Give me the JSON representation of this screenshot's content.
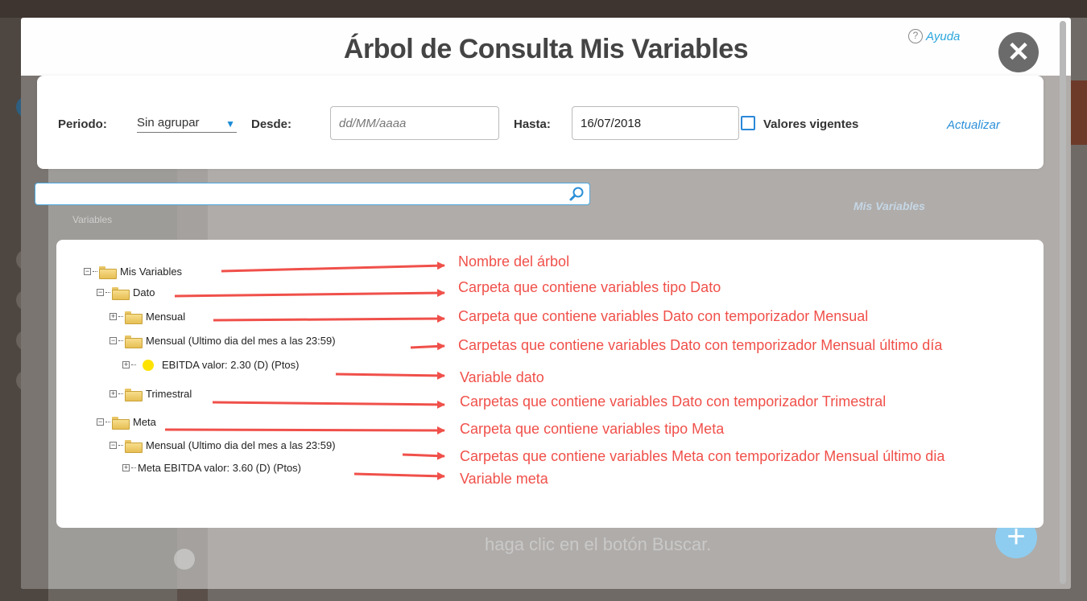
{
  "modal": {
    "title": "Árbol de Consulta Mis Variables",
    "help_label": "Ayuda",
    "help_icon": "help-circle-icon",
    "close_icon": "close-icon"
  },
  "filters": {
    "period_label": "Periodo:",
    "period_value": "Sin agrupar",
    "from_label": "Desde:",
    "from_placeholder": "dd/MM/aaaa",
    "to_label": "Hasta:",
    "to_value": "16/07/2018",
    "current_values_label": "Valores vigentes",
    "current_values_checked": false,
    "refresh_label": "Actualizar"
  },
  "search": {
    "value": "",
    "icon": "search-icon"
  },
  "tree": [
    {
      "label": "Mis Variables",
      "toggle": "⊟",
      "icon": "folder-open-icon"
    },
    {
      "label": "Dato",
      "toggle": "⊟",
      "icon": "folder-open-icon"
    },
    {
      "label": "Mensual",
      "toggle": "⊞",
      "icon": "folder-icon"
    },
    {
      "label": "Mensual (Ultimo dia del mes a las 23:59)",
      "toggle": "⊟",
      "icon": "folder-open-icon"
    },
    {
      "label": "EBITDA  valor: 2.30 (D) (Ptos)",
      "toggle": "⊞",
      "icon": "status-yellow-icon"
    },
    {
      "label": "Trimestral",
      "toggle": "⊞",
      "icon": "folder-icon"
    },
    {
      "label": "Meta",
      "toggle": "⊟",
      "icon": "folder-open-icon"
    },
    {
      "label": "Mensual (Ultimo dia del mes a las 23:59)",
      "toggle": "⊟",
      "icon": "folder-open-icon"
    },
    {
      "label": "Meta EBITDA  valor: 3.60 (D) (Ptos)",
      "toggle": "⊞",
      "icon": "none"
    }
  ],
  "annotations": [
    "Nombre del árbol",
    "Carpeta que contiene variables tipo Dato",
    "Carpeta que contiene variables Dato con temporizador Mensual",
    "Carpetas que contiene variables Dato con temporizador Mensual último día",
    "Variable dato",
    "Carpetas que contiene variables Dato con temporizador Trimestral",
    "Carpeta que contiene variables tipo Meta",
    "Carpetas que contiene variables Meta con temporizador Mensual último dia",
    "Variable meta"
  ],
  "background": {
    "mis_variables": "Mis Variables",
    "variables_select": "Variables",
    "hint_text": "haga clic en el botón Buscar."
  },
  "colors": {
    "accent": "#2a8fd8",
    "annotation": "#f0504a",
    "close_button": "#6b6b6b"
  }
}
